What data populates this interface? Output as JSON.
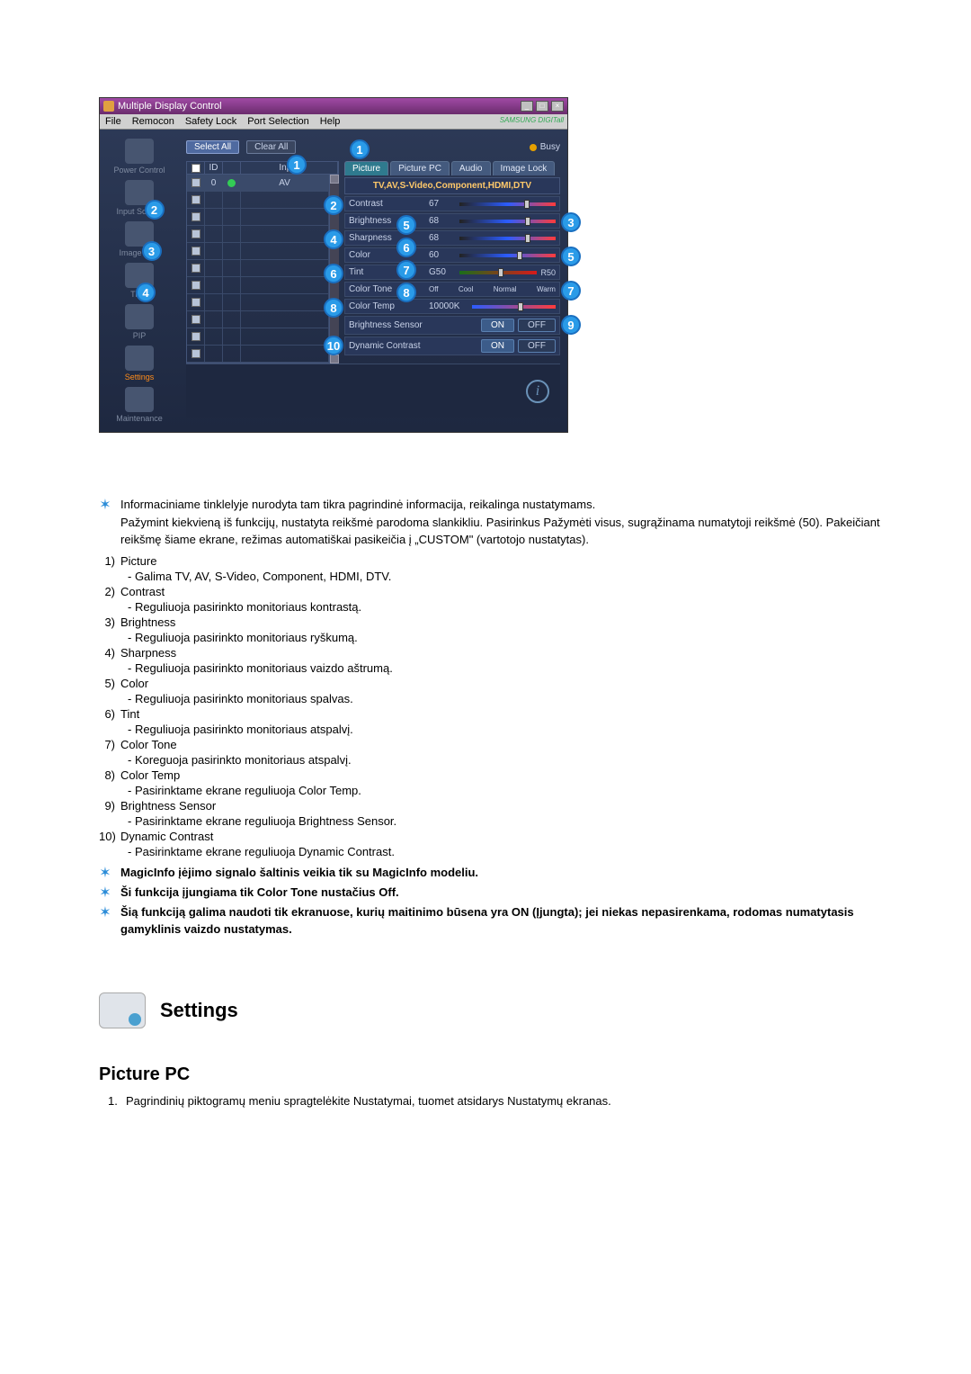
{
  "window": {
    "title": "Multiple Display Control",
    "menus": [
      "File",
      "Remocon",
      "Safety Lock",
      "Port Selection",
      "Help"
    ],
    "brand": "SAMSUNG DIGITall"
  },
  "sidebar": {
    "items": [
      {
        "label": "Power Control"
      },
      {
        "label": "Input Source"
      },
      {
        "label": "Image Size"
      },
      {
        "label": "Time"
      },
      {
        "label": "PIP"
      },
      {
        "label": "Settings"
      },
      {
        "label": "Maintenance"
      }
    ]
  },
  "toolbar": {
    "select_all": "Select All",
    "clear_all": "Clear All",
    "busy": "Busy"
  },
  "grid": {
    "headers": {
      "id": "ID",
      "input": "Input"
    },
    "row0": {
      "id": "0",
      "input": "AV"
    }
  },
  "tabs": {
    "picture": "Picture",
    "picture_pc": "Picture PC",
    "audio": "Audio",
    "image_lock": "Image Lock"
  },
  "panel": {
    "subtitle": "TV,AV,S-Video,Component,HDMI,DTV",
    "contrast": {
      "label": "Contrast",
      "val": "67"
    },
    "brightness": {
      "label": "Brightness",
      "val": "68"
    },
    "sharpness": {
      "label": "Sharpness",
      "val": "68"
    },
    "color": {
      "label": "Color",
      "val": "60"
    },
    "tint": {
      "label": "Tint",
      "left": "G50",
      "right": "R50"
    },
    "color_tone": {
      "label": "Color Tone",
      "opts": [
        "Off",
        "Cool",
        "Normal",
        "Warm"
      ]
    },
    "color_temp": {
      "label": "Color Temp",
      "val": "10000K"
    },
    "brightness_sensor": {
      "label": "Brightness Sensor",
      "on": "ON",
      "off": "OFF"
    },
    "dynamic_contrast": {
      "label": "Dynamic Contrast",
      "on": "ON",
      "off": "OFF"
    }
  },
  "callouts": [
    "1",
    "2",
    "3",
    "4",
    "5",
    "6",
    "7",
    "8",
    "9",
    "10"
  ],
  "desc": {
    "intro1": "Informaciniame tinklelyje nurodyta tam tikra pagrindinė informacija, reikalinga nustatymams.",
    "intro2": "Pažymint kiekvieną iš funkcijų, nustatyta reikšmė parodoma slankikliu. Pasirinkus Pažymėti visus, sugrąžinama numatytoji reikšmė (50). Pakeičiant reikšmę šiame ekrane, režimas automatiškai pasikeičia į „CUSTOM\" (vartotojo nustatytas).",
    "items": [
      {
        "n": "1)",
        "t": "Picture",
        "d": "- Galima TV, AV, S-Video, Component, HDMI, DTV."
      },
      {
        "n": "2)",
        "t": "Contrast",
        "d": "- Reguliuoja pasirinkto monitoriaus kontrastą."
      },
      {
        "n": "3)",
        "t": "Brightness",
        "d": "- Reguliuoja pasirinkto monitoriaus ryškumą."
      },
      {
        "n": "4)",
        "t": "Sharpness",
        "d": "- Reguliuoja pasirinkto monitoriaus vaizdo aštrumą."
      },
      {
        "n": "5)",
        "t": "Color",
        "d": "- Reguliuoja pasirinkto monitoriaus spalvas."
      },
      {
        "n": "6)",
        "t": "Tint",
        "d": "- Reguliuoja pasirinkto monitoriaus atspalvį."
      },
      {
        "n": "7)",
        "t": "Color Tone",
        "d": "- Koreguoja pasirinkto monitoriaus atspalvį."
      },
      {
        "n": "8)",
        "t": "Color Temp",
        "d": "- Pasirinktame ekrane reguliuoja Color Temp."
      },
      {
        "n": "9)",
        "t": "Brightness Sensor",
        "d": "- Pasirinktame ekrane reguliuoja Brightness Sensor."
      },
      {
        "n": "10)",
        "t": "Dynamic Contrast",
        "d": "- Pasirinktame ekrane reguliuoja Dynamic Contrast."
      }
    ],
    "note1": "MagicInfo įėjimo signalo šaltinis veikia tik su MagicInfo modeliu.",
    "note2": "Ši funkcija įjungiama tik Color Tone nustačius Off.",
    "note3": "Šią funkciją galima naudoti tik ekranuose, kurių maitinimo būsena yra ON (Įjungta); jei niekas nepasirenkama, rodomas numatytasis gamyklinis vaizdo nustatymas."
  },
  "section": {
    "heading": "Settings",
    "subsection": "Picture PC",
    "step1_n": "1.",
    "step1": "Pagrindinių piktogramų meniu spragtelėkite Nustatymai, tuomet atsidarys Nustatymų ekranas."
  }
}
